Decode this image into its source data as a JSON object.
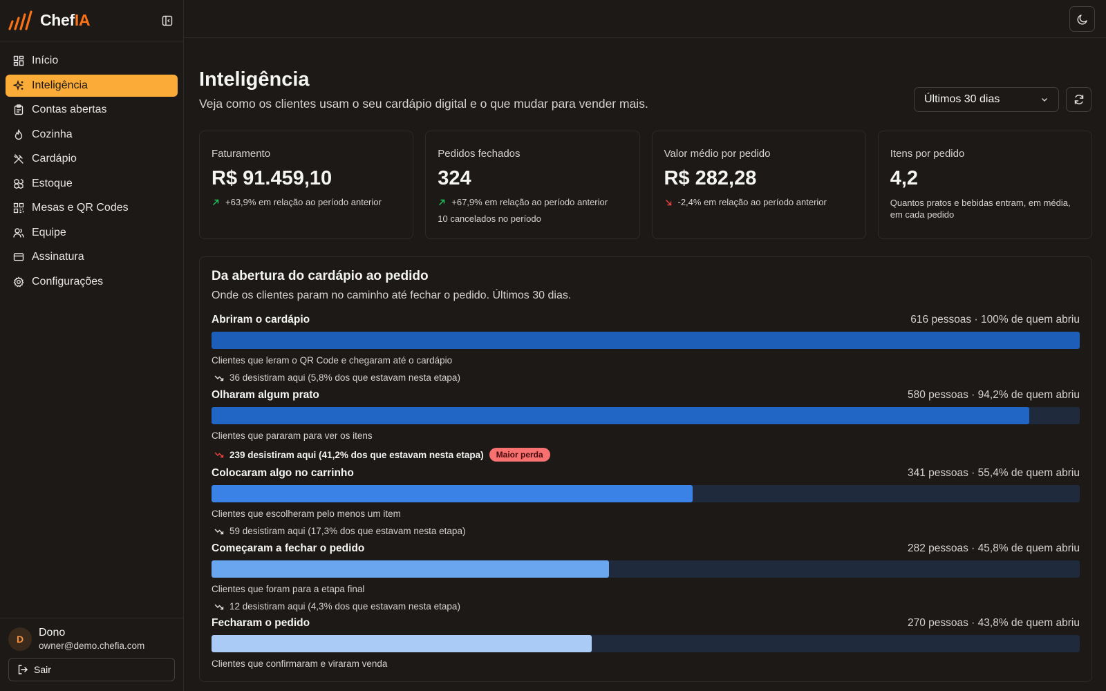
{
  "brand": {
    "name_main": "Chef",
    "name_accent": "IA",
    "accent": "#f97316"
  },
  "sidebar": {
    "items": [
      {
        "label": "Início",
        "icon": "grid-icon"
      },
      {
        "label": "Inteligência",
        "icon": "sparkles-icon",
        "active": true
      },
      {
        "label": "Contas abertas",
        "icon": "clipboard-icon"
      },
      {
        "label": "Cozinha",
        "icon": "flame-icon"
      },
      {
        "label": "Cardápio",
        "icon": "utensils-icon"
      },
      {
        "label": "Estoque",
        "icon": "boxes-icon"
      },
      {
        "label": "Mesas e QR Codes",
        "icon": "qr-code-icon"
      },
      {
        "label": "Equipe",
        "icon": "users-icon"
      },
      {
        "label": "Assinatura",
        "icon": "credit-card-icon"
      },
      {
        "label": "Configurações",
        "icon": "gear-icon"
      }
    ]
  },
  "user": {
    "initial": "D",
    "name": "Dono",
    "email": "owner@demo.chefia.com",
    "logout_label": "Sair"
  },
  "header": {
    "title": "Inteligência",
    "subtitle": "Veja como os clientes usam o seu cardápio digital e o que mudar para vender mais.",
    "period": "Últimos 30 dias"
  },
  "kpis": [
    {
      "label": "Faturamento",
      "value": "R$ 91.459,10",
      "delta": "+63,9% em relação ao período anterior",
      "trend": "up"
    },
    {
      "label": "Pedidos fechados",
      "value": "324",
      "delta": "+67,9% em relação ao período anterior",
      "trend": "up",
      "note": "10 cancelados no período"
    },
    {
      "label": "Valor médio por pedido",
      "value": "R$ 282,28",
      "delta": "-2,4% em relação ao período anterior",
      "trend": "down"
    },
    {
      "label": "Itens por pedido",
      "value": "4,2",
      "desc": "Quantos pratos e bebidas entram, em média, em cada pedido"
    }
  ],
  "funnel": {
    "title": "Da abertura do cardápio ao pedido",
    "subtitle": "Onde os clientes param no caminho até fechar o pedido. Últimos 30 dias.",
    "stages": [
      {
        "name": "Abriram o cardápio",
        "count": "616 pessoas · 100% de quem abriu",
        "fraction": 1.0,
        "color": "#1d5fb8",
        "desc": "Clientes que leram o QR Code e chegaram até o cardápio",
        "drop": "36 desistiram aqui (5,8% dos que estavam nesta etapa)"
      },
      {
        "name": "Olharam algum prato",
        "count": "580 pessoas · 94,2% de quem abriu",
        "fraction": 0.942,
        "color": "#2166c4",
        "desc": "Clientes que pararam para ver os itens",
        "drop": "239 desistiram aqui (41,2% dos que estavam nesta etapa)",
        "major": true,
        "badge": "Maior perda"
      },
      {
        "name": "Colocaram algo no carrinho",
        "count": "341 pessoas · 55,4% de quem abriu",
        "fraction": 0.554,
        "color": "#3b82e6",
        "desc": "Clientes que escolheram pelo menos um item",
        "drop": "59 desistiram aqui (17,3% dos que estavam nesta etapa)"
      },
      {
        "name": "Começaram a fechar o pedido",
        "count": "282 pessoas · 45,8% de quem abriu",
        "fraction": 0.458,
        "color": "#6aa6f0",
        "desc": "Clientes que foram para a etapa final",
        "drop": "12 desistiram aqui (4,3% dos que estavam nesta etapa)"
      },
      {
        "name": "Fecharam o pedido",
        "count": "270 pessoas · 43,8% de quem abriu",
        "fraction": 0.438,
        "color": "#a9cbf6",
        "desc": "Clientes que confirmaram e viraram venda"
      }
    ]
  }
}
